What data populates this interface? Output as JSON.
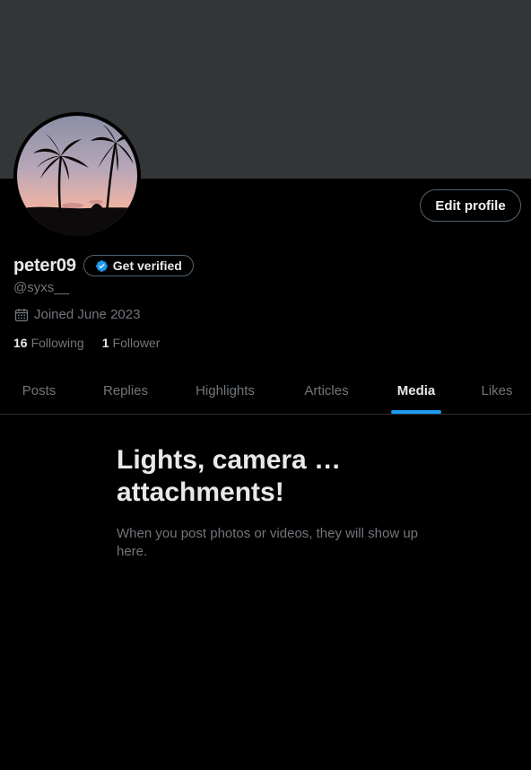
{
  "profile": {
    "display_name": "peter09",
    "handle": "@syxs__",
    "joined": "Joined June 2023",
    "edit_label": "Edit profile",
    "verify_label": "Get verified",
    "following_count": "16",
    "following_label": "Following",
    "followers_count": "1",
    "followers_label": "Follower"
  },
  "tabs": [
    {
      "label": "Posts"
    },
    {
      "label": "Replies"
    },
    {
      "label": "Highlights"
    },
    {
      "label": "Articles"
    },
    {
      "label": "Media",
      "active": true
    },
    {
      "label": "Likes"
    }
  ],
  "empty_state": {
    "title": "Lights, camera … attachments!",
    "body": "When you post photos or videos, they will show up here."
  },
  "colors": {
    "background": "#000000",
    "banner": "#333639",
    "accent": "#1d9bf0",
    "muted_text": "#71767b",
    "primary_text": "#e7e9ea"
  },
  "icons": {
    "verified": "verified-badge-icon",
    "calendar": "calendar-icon"
  }
}
